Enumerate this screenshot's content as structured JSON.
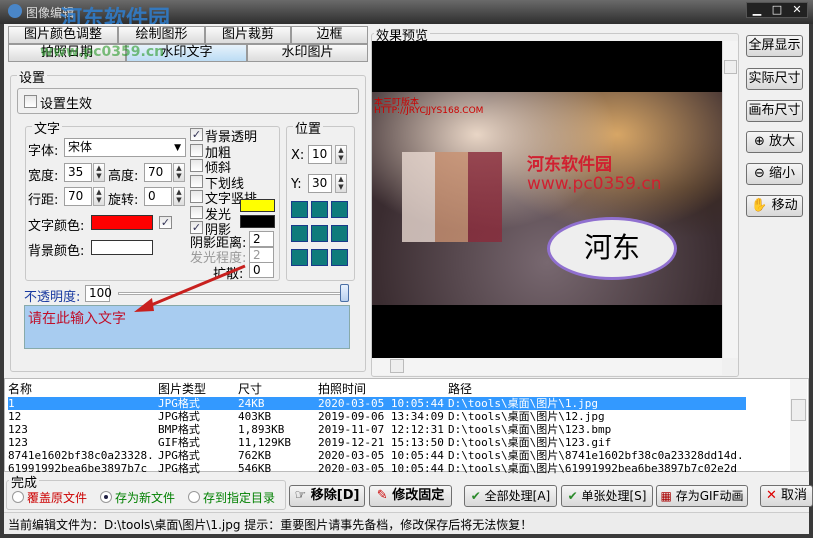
{
  "window": {
    "title": "图像编辑",
    "watermark_logo": "河东软件园",
    "watermark_url": "www.pc0359.cn"
  },
  "tabs_row1": [
    "图片颜色调整",
    "绘制图形",
    "图片裁剪",
    "边框"
  ],
  "tabs_row2": [
    "拍照日期",
    "水印文字",
    "水印图片"
  ],
  "selected_tab": "水印文字",
  "settings": {
    "group": "设置",
    "enable_label": "设置生效",
    "enable_checked": false,
    "text_group": "文字",
    "font_label": "字体:",
    "font_value": "宋体",
    "width_label": "宽度:",
    "width_value": "35",
    "height_label": "高度:",
    "height_value": "70",
    "spacing_label": "行距:",
    "spacing_value": "70",
    "rotate_label": "旋转:",
    "rotate_value": "0",
    "text_color_label": "文字颜色:",
    "text_color": "#ff0000",
    "bg_color_label": "背景颜色:",
    "bg_color": "#ffffff",
    "options": [
      {
        "label": "背景透明",
        "checked": true
      },
      {
        "label": "加粗",
        "checked": false
      },
      {
        "label": "倾斜",
        "checked": false
      },
      {
        "label": "下划线",
        "checked": false
      },
      {
        "label": "文字竖排",
        "checked": false
      },
      {
        "label": "发光",
        "checked": false
      },
      {
        "label": "阴影",
        "checked": true
      }
    ],
    "glow_color": "#ffff00",
    "shadow_color": "#000000",
    "shadow_dist_label": "阴影距离:",
    "shadow_dist": "2",
    "glow_level_label": "发光程度:",
    "glow_level": "2",
    "spread_label": "扩散:",
    "spread": "0",
    "position_group": "位置",
    "x_label": "X:",
    "x_value": "10",
    "y_label": "Y:",
    "y_value": "30",
    "opacity_label": "不透明度:",
    "opacity_value": "100",
    "opacity_fraction": 1.0,
    "text_input": "请在此输入文字"
  },
  "preview": {
    "group": "效果预览",
    "overlay_line1": "本三叮版本",
    "overlay_line2": "HTTP://JRYCJJYS168.COM",
    "wm_line1": "河东软件园",
    "wm_line2": "www.pc0359.cn",
    "bubble_text": "河东"
  },
  "side_buttons": [
    "全屏显示",
    "实际尺寸",
    "画布尺寸",
    "放大",
    "缩小",
    "移动"
  ],
  "table": {
    "headers": [
      "名称",
      "图片类型",
      "尺寸",
      "拍照时间",
      "路径"
    ],
    "rows": [
      [
        "1",
        "JPG格式",
        "24KB",
        "2020-03-05 10:05:44",
        "D:\\tools\\桌面\\图片\\1.jpg"
      ],
      [
        "12",
        "JPG格式",
        "403KB",
        "2019-09-06 13:34:09",
        "D:\\tools\\桌面\\图片\\12.jpg"
      ],
      [
        "123",
        "BMP格式",
        "1,893KB",
        "2019-11-07 12:12:31",
        "D:\\tools\\桌面\\图片\\123.bmp"
      ],
      [
        "123",
        "GIF格式",
        "11,129KB",
        "2019-12-21 15:13:50",
        "D:\\tools\\桌面\\图片\\123.gif"
      ],
      [
        "8741e1602bf38c0a23328...",
        "JPG格式",
        "762KB",
        "2020-03-05 10:05:44",
        "D:\\tools\\桌面\\图片\\8741e1602bf38c0a23328dd14d..."
      ],
      [
        "61991992bea6be3897b7c",
        "JPG格式",
        "546KB",
        "2020-03-05 10:05:44",
        "D:\\tools\\桌面\\图片\\61991992bea6be3897b7c02e2d"
      ]
    ]
  },
  "done": {
    "group": "完成",
    "radios": [
      {
        "label": "覆盖原文件",
        "checked": false,
        "color": "#cc0000"
      },
      {
        "label": "存为新文件",
        "checked": true,
        "color": "#008000"
      },
      {
        "label": "存到指定目录",
        "checked": false,
        "color": "#008000"
      }
    ]
  },
  "actions": {
    "remove": "移除[D]",
    "fix": "修改固定",
    "all": "全部处理[A]",
    "single": "单张处理[S]",
    "gif": "存为GIF动画",
    "cancel": "取消"
  },
  "status": "当前编辑文件为：D:\\tools\\桌面\\图片\\1.jpg  提示：重要图片请事先备档，修改保存后将无法恢复！"
}
